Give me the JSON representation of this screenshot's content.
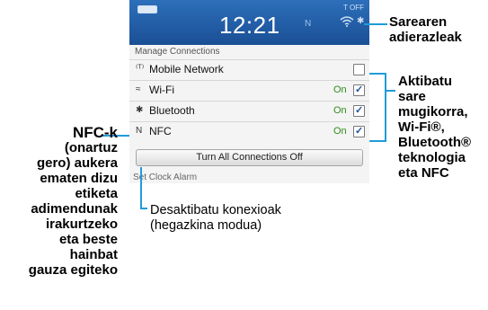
{
  "status_bar": {
    "time": "12:21",
    "notification_icon": "n-icon",
    "signal_label": "T OFF",
    "icons": [
      "battery-icon",
      "wifi-icon",
      "bluetooth-icon"
    ]
  },
  "menu": {
    "header": "Manage Connections",
    "rows": [
      {
        "icon": "antenna-icon",
        "icon_glyph": "⁽ᵀ⁾",
        "label": "Mobile Network",
        "on_text": "",
        "checked": false
      },
      {
        "icon": "wifi-icon",
        "icon_glyph": "≈",
        "label": "Wi-Fi",
        "on_text": "On",
        "checked": true
      },
      {
        "icon": "bluetooth-icon",
        "icon_glyph": "✱",
        "label": "Bluetooth",
        "on_text": "On",
        "checked": true
      },
      {
        "icon": "nfc-icon",
        "icon_glyph": "N",
        "label": "NFC",
        "on_text": "On",
        "checked": true
      }
    ],
    "turn_off_label": "Turn All Connections Off",
    "next_item": "Set Clock Alarm"
  },
  "callouts": {
    "status_indicators": [
      "Sarearen",
      "adierazleak"
    ],
    "activate": [
      "Aktibatu",
      "sare",
      "mugikorra,",
      "Wi-Fi®,",
      "Bluetooth®",
      "teknologia",
      "eta NFC"
    ],
    "deactivate": [
      "Desaktibatu konexioak",
      "(hegazkina modua)"
    ],
    "nfc": [
      "NFC-k",
      "(onartuz",
      "gero) aukera",
      "ematen dizu",
      "etiketa",
      "adimendunak",
      "irakurtzeko",
      "eta beste",
      "hainbat",
      "gauza egiteko"
    ]
  },
  "colors": {
    "status_bar": "#1a4f95",
    "callout_line": "#1f9cd9",
    "on_text": "#2f8a1c"
  }
}
